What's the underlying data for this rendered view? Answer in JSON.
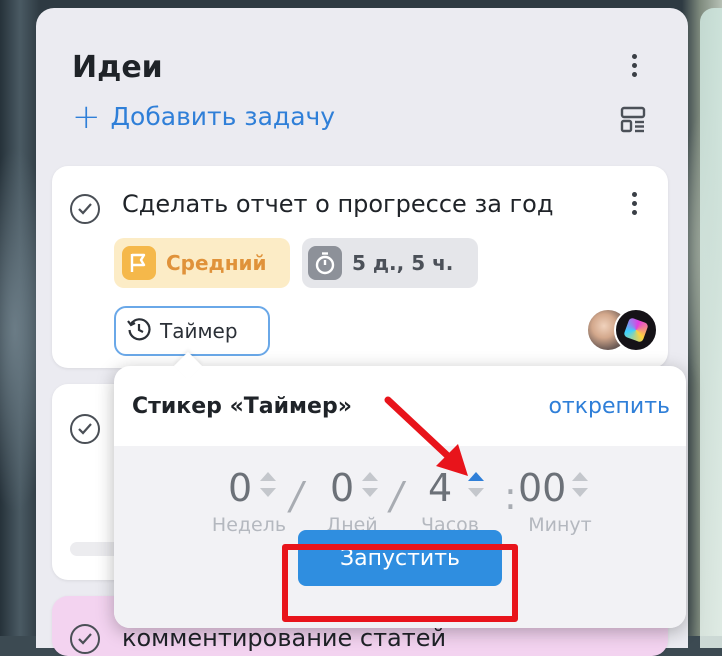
{
  "column": {
    "title": "Идеи",
    "add_task_label": "Добавить задачу"
  },
  "cards": [
    {
      "title": "Сделать отчет о прогрессе за год",
      "priority": "Средний",
      "time_estimate": "5 д., 5 ч.",
      "timer_label": "Таймер"
    },
    {
      "title": "комментирование статей"
    }
  ],
  "popup": {
    "title": "Стикер «Таймер»",
    "unpin_label": "открепить",
    "fields": [
      {
        "value": "0",
        "label": "Недель"
      },
      {
        "value": "0",
        "label": "Дней"
      },
      {
        "value": "4",
        "label": "Часов"
      },
      {
        "value": "00",
        "label": "Минут"
      }
    ],
    "separators": [
      "/",
      "/",
      ":"
    ],
    "start_label": "Запустить"
  },
  "colors": {
    "accent": "#2f7fd8",
    "priority_bg": "#fcecc6",
    "priority_text": "#e0923a",
    "highlight": "#e8141b",
    "third_card_bg": "#f3d3f0"
  },
  "icons": {
    "check": "check-circle-icon",
    "menu": "kebab-menu-icon",
    "priority": "flag-icon",
    "time": "stopwatch-icon",
    "timer": "history-clock-icon",
    "layout": "layout-icon",
    "spinner": "up-down-spinner-icon"
  }
}
